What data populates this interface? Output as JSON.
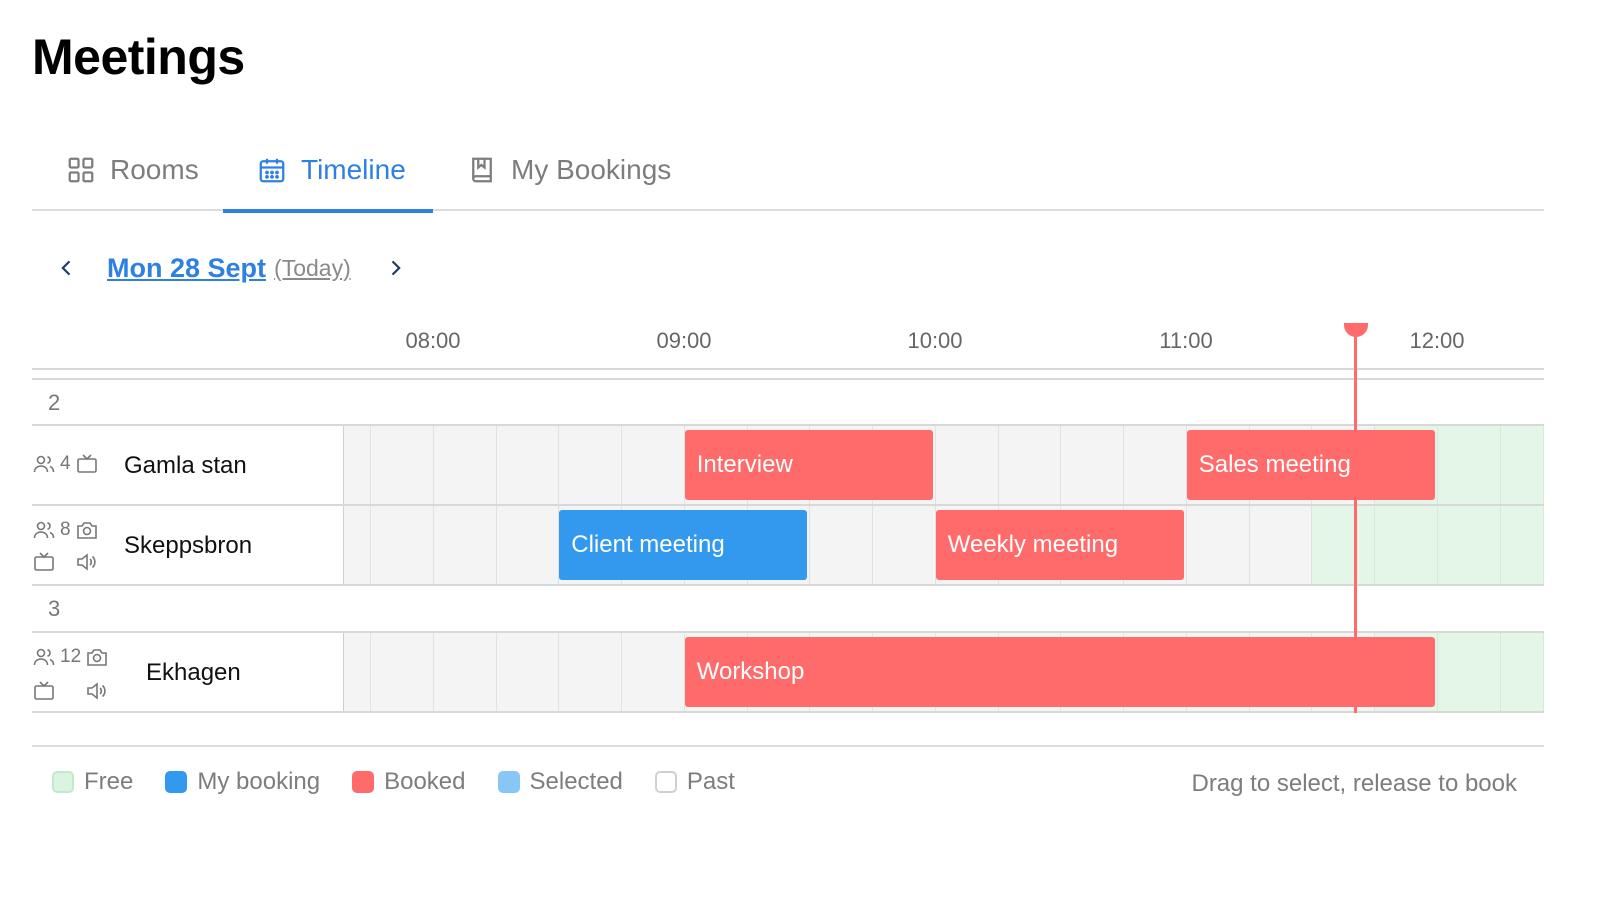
{
  "page": {
    "title": "Meetings"
  },
  "tabs": [
    {
      "label": "Rooms",
      "icon": "grid-icon",
      "active": false
    },
    {
      "label": "Timeline",
      "icon": "calendar-icon",
      "active": true
    },
    {
      "label": "My Bookings",
      "icon": "bookmark-book-icon",
      "active": false
    }
  ],
  "date_nav": {
    "date": "Mon 28 Sept",
    "today": "(Today)"
  },
  "timeline": {
    "hours": [
      "08:00",
      "09:00",
      "10:00",
      "11:00",
      "12:00"
    ],
    "groups": [
      {
        "label": "2",
        "rooms": [
          {
            "name": "Gamla stan",
            "capacity": "4",
            "features": [
              "tv"
            ],
            "bookings": [
              {
                "title": "Interview",
                "start": "09:00",
                "end": "10:00",
                "type": "booked"
              },
              {
                "title": "Sales meeting",
                "start": "11:00",
                "end": "12:00",
                "type": "booked"
              }
            ]
          },
          {
            "name": "Skeppsbron",
            "capacity": "8",
            "features": [
              "camera",
              "tv",
              "speaker"
            ],
            "bookings": [
              {
                "title": "Client meeting",
                "start": "08:30",
                "end": "09:30",
                "type": "mine"
              },
              {
                "title": "Weekly meeting",
                "start": "10:00",
                "end": "11:00",
                "type": "booked"
              }
            ]
          }
        ]
      },
      {
        "label": "3",
        "rooms": [
          {
            "name": "Ekhagen",
            "capacity": "12",
            "features": [
              "camera",
              "tv",
              "speaker"
            ],
            "bookings": [
              {
                "title": "Workshop",
                "start": "09:00",
                "end": "12:00",
                "type": "booked"
              }
            ]
          }
        ]
      }
    ]
  },
  "legend": [
    {
      "label": "Free",
      "color": "#d9f5e0",
      "border": "#c3e8cc"
    },
    {
      "label": "My booking",
      "color": "#3399ee",
      "border": "#3399ee"
    },
    {
      "label": "Booked",
      "color": "#ff6b6b",
      "border": "#ff6b6b"
    },
    {
      "label": "Selected",
      "color": "#88c6f5",
      "border": "#88c6f5"
    },
    {
      "label": "Past",
      "color": "#ffffff",
      "border": "#d0d0d0"
    }
  ],
  "hint": "Drag to select, release to book",
  "colors": {
    "accent": "#2f80e3",
    "booked": "#ff6b6b",
    "mine": "#3399ee",
    "free": "#e3f6e8",
    "past": "#f4f4f4"
  }
}
